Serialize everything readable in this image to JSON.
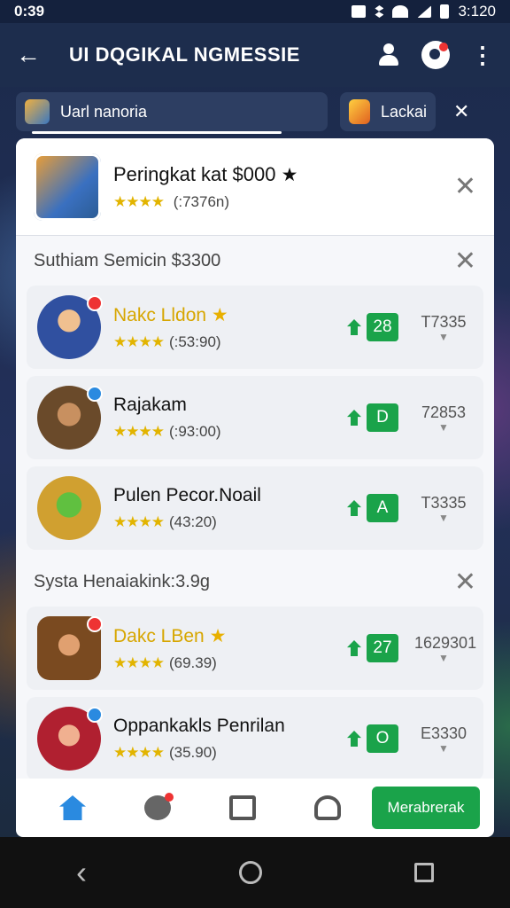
{
  "status": {
    "time": "0:39",
    "clock": "3:120"
  },
  "appbar": {
    "title": "UI DQGIKAL NGMESSIE"
  },
  "search": {
    "value": "Uarl nanoria"
  },
  "tag_chip": {
    "label": "Lackai"
  },
  "top_card": {
    "title": "Peringkat kat $000",
    "stars": "★★★★",
    "rating": "(:7376n)"
  },
  "section1": {
    "title": "Suthiam Semicin $3300",
    "rows": [
      {
        "name": "Nakc Lldon",
        "gold": true,
        "stars": "★★★★",
        "rating": "(:53:90)",
        "score": "28",
        "rank": "T7335"
      },
      {
        "name": "Rajakam",
        "gold": false,
        "stars": "★★★★",
        "rating": "(:93:00)",
        "score": "D",
        "rank": "72853"
      },
      {
        "name": "Pulen Pecor.Noail",
        "gold": false,
        "stars": "★★★★",
        "rating": "(43:20)",
        "score": "A",
        "rank": "T3335"
      }
    ]
  },
  "section2": {
    "title": "Systa Henaiakink:3.9g",
    "rows": [
      {
        "name": "Dakc LBen",
        "gold": true,
        "stars": "★★★★",
        "rating": "(69.39)",
        "score": "27",
        "rank": "1629301"
      },
      {
        "name": "Oppankakls Penrilan",
        "gold": false,
        "stars": "★★★★",
        "rating": "(35.90)",
        "score": "O",
        "rank": "E3330"
      }
    ]
  },
  "bottom_nav": {
    "cta": "Merabrerak"
  }
}
